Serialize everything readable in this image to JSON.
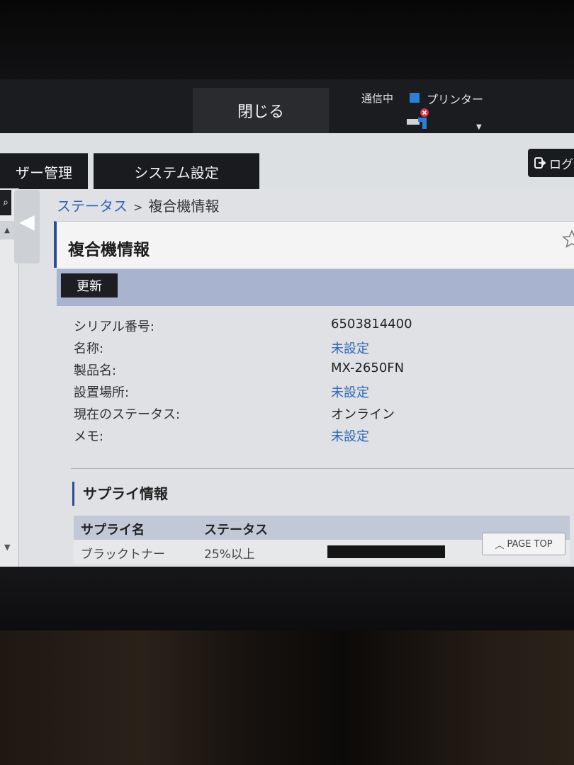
{
  "header": {
    "close_label": "閉じる",
    "comm_status": "通信中",
    "device_label": "プリンター",
    "indicator_color": "#2a7fd8"
  },
  "tabs": [
    {
      "label": "ザー管理"
    },
    {
      "label": "システム設定"
    }
  ],
  "logout_label": "ログ",
  "breadcrumb": {
    "parent": "ステータス",
    "separator": ">",
    "current": "複合機情報"
  },
  "page": {
    "title": "複合機情報",
    "refresh_label": "更新"
  },
  "info": [
    {
      "label": "シリアル番号:",
      "value": "6503814400"
    },
    {
      "label": "名称:",
      "value": "未設定"
    },
    {
      "label": "製品名:",
      "value": "MX-2650FN"
    },
    {
      "label": "設置場所:",
      "value": "未設定"
    },
    {
      "label": "現在のステータス:",
      "value": "オンライン"
    },
    {
      "label": "メモ:",
      "value": "未設定"
    }
  ],
  "supply": {
    "section_title": "サプライ情報",
    "columns": [
      "サプライ名",
      "ステータス"
    ],
    "rows": [
      {
        "name": "ブラックトナー",
        "status": "25%以上",
        "level": 1.0
      }
    ]
  },
  "page_top_label": "PAGE TOP",
  "colors": {
    "accent": "#2b4d96",
    "link": "#2f66b8",
    "header_dark": "#1b1c1f"
  }
}
